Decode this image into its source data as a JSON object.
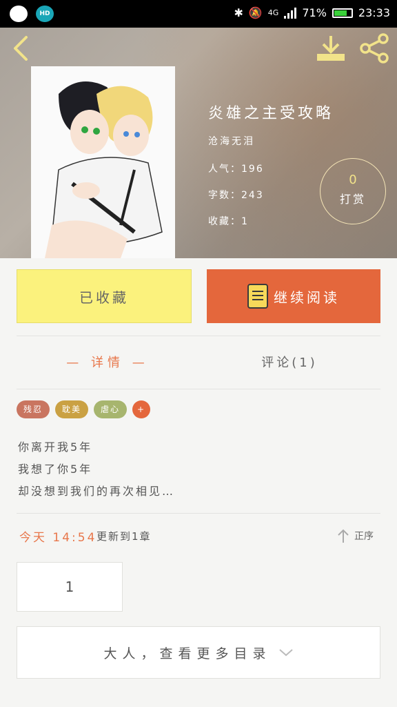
{
  "status_bar": {
    "battery": "71%",
    "time": "23:33",
    "network": "4G",
    "hd_badge": "HD"
  },
  "book": {
    "title": "炎雄之主受攻略",
    "author": "沧海无泪",
    "popularity_label": "人气",
    "popularity": "196",
    "word_count_label": "字数",
    "word_count": "243",
    "favorites_label": "收藏",
    "favorites": "1",
    "separator": "：",
    "tip_count": "0",
    "tip_label": "打赏"
  },
  "actions": {
    "favorite_label": "已收藏",
    "continue_label": "继续阅读"
  },
  "tabs": {
    "detail": "— 详情 —",
    "comments": "评论(1)"
  },
  "tags": [
    {
      "label": "残忍",
      "color": "#c97560"
    },
    {
      "label": "耽美",
      "color": "#caa143"
    },
    {
      "label": "虐心",
      "color": "#a7b56e"
    },
    {
      "label": "+",
      "color": "#e4673c"
    }
  ],
  "synopsis": [
    "你离开我5年",
    "我想了你5年",
    "却没想到我们的再次相见…"
  ],
  "update": {
    "time": "今天 14:54",
    "text": "更新到1章",
    "sort_label": "正序"
  },
  "chapters": [
    "1"
  ],
  "more_catalog_label": "大人，查看更多目录",
  "colors": {
    "accent": "#e4673c",
    "favorite_bg": "#fbf27d",
    "icon_yellow": "#f2e38a"
  }
}
